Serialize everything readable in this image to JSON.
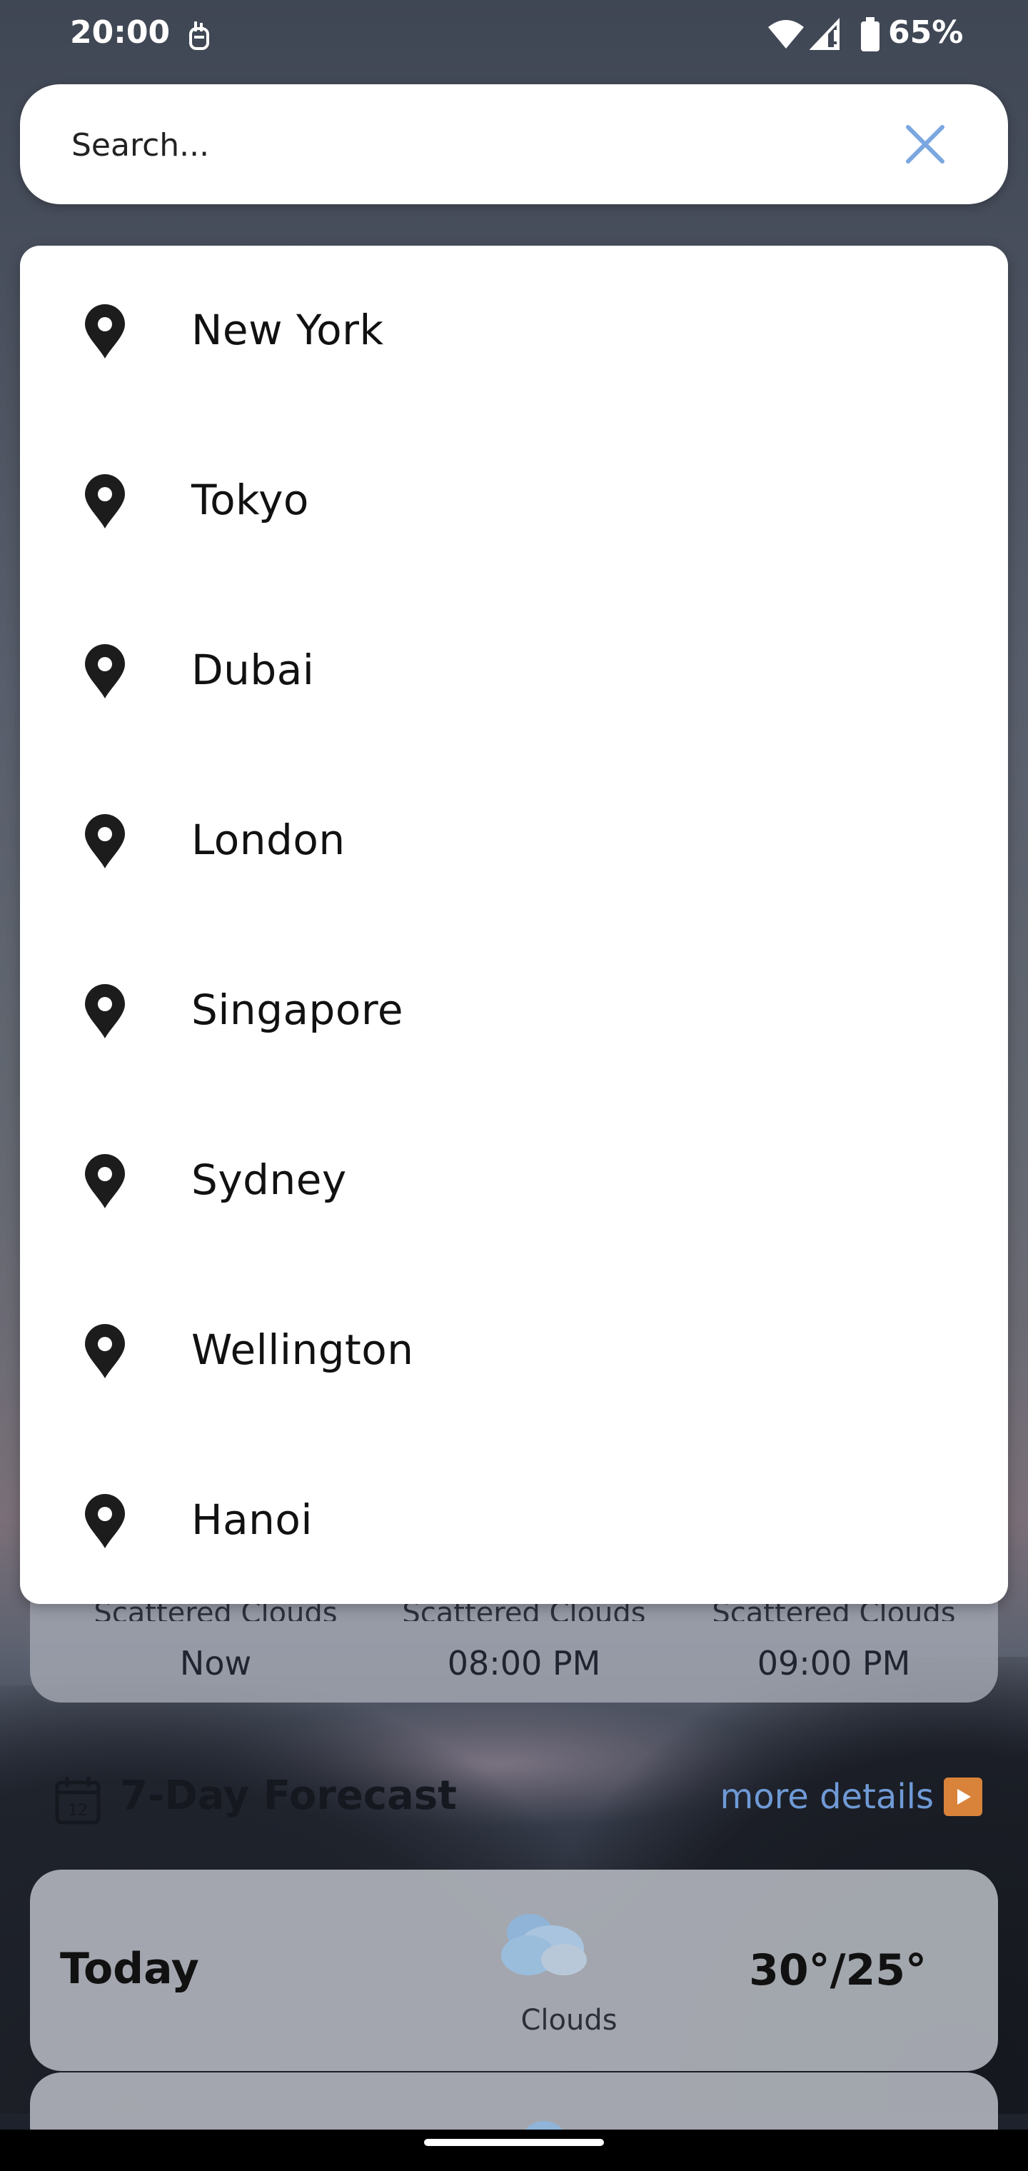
{
  "status_bar": {
    "time": "20:00",
    "battery": "65%",
    "icons": [
      "hand-icon",
      "wifi-icon",
      "signal-icon",
      "battery-icon"
    ]
  },
  "search": {
    "placeholder": "Search...",
    "value": "",
    "clear_icon": "close-icon",
    "accent_color": "#7aa7e0"
  },
  "suggestions": [
    {
      "city": "New York"
    },
    {
      "city": "Tokyo"
    },
    {
      "city": "Dubai"
    },
    {
      "city": "London"
    },
    {
      "city": "Singapore"
    },
    {
      "city": "Sydney"
    },
    {
      "city": "Wellington"
    },
    {
      "city": "Hanoi"
    }
  ],
  "hourly": [
    {
      "condition": "Scattered Clouds",
      "time": "Now"
    },
    {
      "condition": "Scattered Clouds",
      "time": "08:00 PM"
    },
    {
      "condition": "Scattered Clouds",
      "time": "09:00 PM"
    }
  ],
  "forecast": {
    "title": "7-Day Forecast",
    "more_details": "more details",
    "days": [
      {
        "day": "Today",
        "condition": "Clouds",
        "temp": "30°/25°",
        "icon": "clouds-icon"
      }
    ]
  }
}
